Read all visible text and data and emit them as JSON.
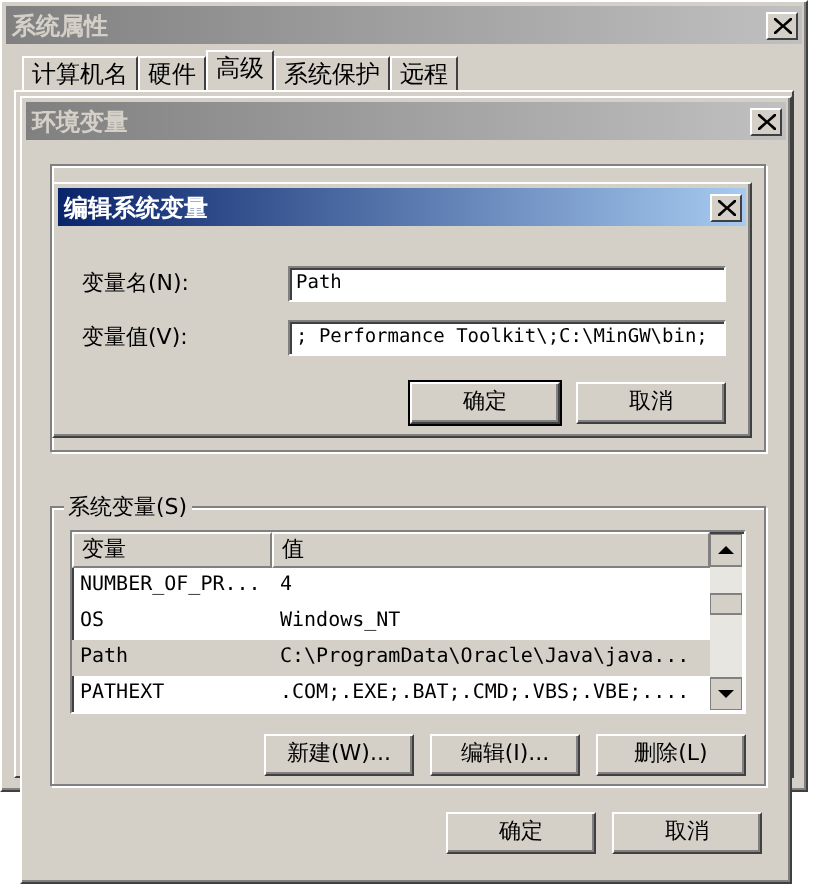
{
  "system_properties": {
    "title": "系统属性",
    "active": false,
    "tabs": [
      {
        "label": "计算机名",
        "selected": false
      },
      {
        "label": "硬件",
        "selected": false
      },
      {
        "label": "高级",
        "selected": true
      },
      {
        "label": "系统保护",
        "selected": false
      },
      {
        "label": "远程",
        "selected": false
      }
    ]
  },
  "environment_variables": {
    "title": "环境变量",
    "active": false,
    "system_variables": {
      "label": "系统变量(S)",
      "columns": [
        "变量",
        "值"
      ],
      "rows": [
        {
          "name": "NUMBER_OF_PR...",
          "value": "4",
          "selected": false
        },
        {
          "name": "OS",
          "value": "Windows_NT",
          "selected": false
        },
        {
          "name": "Path",
          "value": "C:\\ProgramData\\Oracle\\Java\\java...",
          "selected": true
        },
        {
          "name": "PATHEXT",
          "value": ".COM;.EXE;.BAT;.CMD;.VBS;.VBE;....",
          "selected": false
        }
      ],
      "buttons": [
        "新建(W)...",
        "编辑(I)...",
        "删除(L)"
      ]
    },
    "buttons": [
      "确定",
      "取消"
    ]
  },
  "edit_dialog": {
    "title": "编辑系统变量",
    "active": true,
    "fields": [
      {
        "label": "变量名(N):",
        "value": "Path"
      },
      {
        "label": "变量值(V):",
        "value": "; Performance Toolkit\\;C:\\MinGW\\bin;"
      }
    ],
    "buttons": [
      "确定",
      "取消"
    ]
  }
}
